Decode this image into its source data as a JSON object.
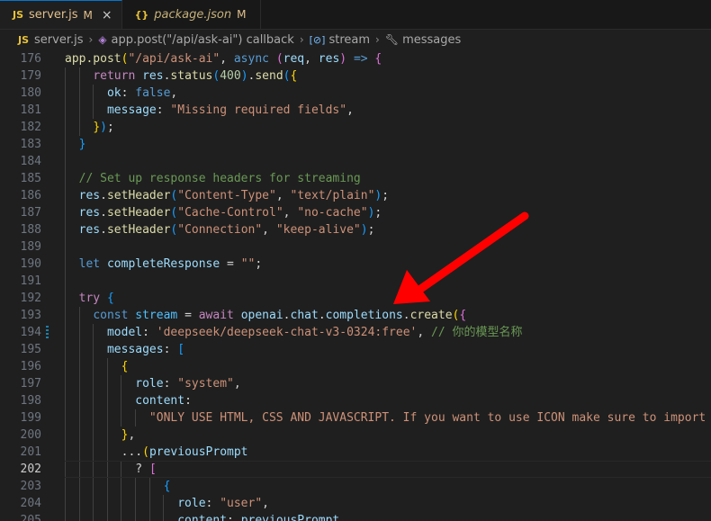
{
  "tabs": [
    {
      "icon": "JS",
      "name": "server.js",
      "modified": "M",
      "close": "×"
    },
    {
      "icon": "{}",
      "name": "package.json",
      "modified": "M"
    }
  ],
  "breadcrumb": [
    "server.js",
    "app.post(\"/api/ask-ai\") callback",
    "stream",
    "messages"
  ],
  "current_line": "202",
  "lines": [
    {
      "n": "176",
      "top": "app.post",
      "tokens": [
        [
          "f",
          "app.post"
        ],
        [
          "b1",
          "("
        ],
        [
          "s",
          "\"/api/ask-ai\""
        ],
        [
          "p",
          ", "
        ],
        [
          "k",
          "async"
        ],
        [
          "p",
          " "
        ],
        [
          "b2",
          "("
        ],
        [
          "v",
          "req"
        ],
        [
          "p",
          ", "
        ],
        [
          "v",
          "res"
        ],
        [
          "b2",
          ")"
        ],
        [
          "p",
          " "
        ],
        [
          "k",
          "=>"
        ],
        [
          "p",
          " "
        ],
        [
          "b2",
          "{"
        ]
      ]
    },
    {
      "n": "179",
      "tokens": [
        [
          "p",
          "    "
        ],
        [
          "kc",
          "return"
        ],
        [
          "p",
          " "
        ],
        [
          "v",
          "res"
        ],
        [
          "p",
          "."
        ],
        [
          "f",
          "status"
        ],
        [
          "b3",
          "("
        ],
        [
          "n",
          "400"
        ],
        [
          "b3",
          ")"
        ],
        [
          "p",
          "."
        ],
        [
          "f",
          "send"
        ],
        [
          "b3",
          "("
        ],
        [
          "b1",
          "{"
        ]
      ]
    },
    {
      "n": "180",
      "tokens": [
        [
          "p",
          "      "
        ],
        [
          "v",
          "ok"
        ],
        [
          "p",
          ": "
        ],
        [
          "k",
          "false"
        ],
        [
          "p",
          ","
        ]
      ]
    },
    {
      "n": "181",
      "tokens": [
        [
          "p",
          "      "
        ],
        [
          "v",
          "message"
        ],
        [
          "p",
          ": "
        ],
        [
          "s",
          "\"Missing required fields\""
        ],
        [
          "p",
          ","
        ]
      ]
    },
    {
      "n": "182",
      "tokens": [
        [
          "p",
          "    "
        ],
        [
          "b1",
          "}"
        ],
        [
          "b3",
          ")"
        ],
        [
          "p",
          ";"
        ]
      ]
    },
    {
      "n": "183",
      "tokens": [
        [
          "p",
          "  "
        ],
        [
          "b3",
          "}"
        ]
      ]
    },
    {
      "n": "184",
      "tokens": []
    },
    {
      "n": "185",
      "tokens": [
        [
          "p",
          "  "
        ],
        [
          "c",
          "// Set up response headers for streaming"
        ]
      ]
    },
    {
      "n": "186",
      "tokens": [
        [
          "p",
          "  "
        ],
        [
          "v",
          "res"
        ],
        [
          "p",
          "."
        ],
        [
          "f",
          "setHeader"
        ],
        [
          "b3",
          "("
        ],
        [
          "s",
          "\"Content-Type\""
        ],
        [
          "p",
          ", "
        ],
        [
          "s",
          "\"text/plain\""
        ],
        [
          "b3",
          ")"
        ],
        [
          "p",
          ";"
        ]
      ]
    },
    {
      "n": "187",
      "tokens": [
        [
          "p",
          "  "
        ],
        [
          "v",
          "res"
        ],
        [
          "p",
          "."
        ],
        [
          "f",
          "setHeader"
        ],
        [
          "b3",
          "("
        ],
        [
          "s",
          "\"Cache-Control\""
        ],
        [
          "p",
          ", "
        ],
        [
          "s",
          "\"no-cache\""
        ],
        [
          "b3",
          ")"
        ],
        [
          "p",
          ";"
        ]
      ]
    },
    {
      "n": "188",
      "tokens": [
        [
          "p",
          "  "
        ],
        [
          "v",
          "res"
        ],
        [
          "p",
          "."
        ],
        [
          "f",
          "setHeader"
        ],
        [
          "b3",
          "("
        ],
        [
          "s",
          "\"Connection\""
        ],
        [
          "p",
          ", "
        ],
        [
          "s",
          "\"keep-alive\""
        ],
        [
          "b3",
          ")"
        ],
        [
          "p",
          ";"
        ]
      ]
    },
    {
      "n": "189",
      "tokens": []
    },
    {
      "n": "190",
      "tokens": [
        [
          "p",
          "  "
        ],
        [
          "k",
          "let"
        ],
        [
          "p",
          " "
        ],
        [
          "v",
          "completeResponse"
        ],
        [
          "p",
          " = "
        ],
        [
          "s",
          "\"\""
        ],
        [
          "p",
          ";"
        ]
      ]
    },
    {
      "n": "191",
      "tokens": []
    },
    {
      "n": "192",
      "tokens": [
        [
          "p",
          "  "
        ],
        [
          "kc",
          "try"
        ],
        [
          "p",
          " "
        ],
        [
          "b3",
          "{"
        ]
      ]
    },
    {
      "n": "193",
      "tokens": [
        [
          "p",
          "    "
        ],
        [
          "k",
          "const"
        ],
        [
          "p",
          " "
        ],
        [
          "cst",
          "stream"
        ],
        [
          "p",
          " = "
        ],
        [
          "kc",
          "await"
        ],
        [
          "p",
          " "
        ],
        [
          "v",
          "openai"
        ],
        [
          "p",
          "."
        ],
        [
          "v",
          "chat"
        ],
        [
          "p",
          "."
        ],
        [
          "v",
          "completions"
        ],
        [
          "p",
          "."
        ],
        [
          "f",
          "create"
        ],
        [
          "b1",
          "("
        ],
        [
          "b2",
          "{"
        ]
      ]
    },
    {
      "n": "194",
      "tokens": [
        [
          "p",
          "      "
        ],
        [
          "v",
          "model"
        ],
        [
          "p",
          ": "
        ],
        [
          "s",
          "'deepseek/deepseek-chat-v3-0324:free'"
        ],
        [
          "p",
          ", "
        ],
        [
          "c",
          "// 你的模型名称"
        ]
      ]
    },
    {
      "n": "195",
      "tokens": [
        [
          "p",
          "      "
        ],
        [
          "v",
          "messages"
        ],
        [
          "p",
          ": "
        ],
        [
          "b3",
          "["
        ]
      ]
    },
    {
      "n": "196",
      "tokens": [
        [
          "p",
          "        "
        ],
        [
          "b1",
          "{"
        ]
      ]
    },
    {
      "n": "197",
      "tokens": [
        [
          "p",
          "          "
        ],
        [
          "v",
          "role"
        ],
        [
          "p",
          ": "
        ],
        [
          "s",
          "\"system\""
        ],
        [
          "p",
          ","
        ]
      ]
    },
    {
      "n": "198",
      "tokens": [
        [
          "p",
          "          "
        ],
        [
          "v",
          "content"
        ],
        [
          "p",
          ":"
        ]
      ]
    },
    {
      "n": "199",
      "tokens": [
        [
          "p",
          "            "
        ],
        [
          "s",
          "\"ONLY USE HTML, CSS AND JAVASCRIPT. If you want to use ICON make sure to import th"
        ]
      ]
    },
    {
      "n": "200",
      "tokens": [
        [
          "p",
          "        "
        ],
        [
          "b1",
          "}"
        ],
        [
          "p",
          ","
        ]
      ]
    },
    {
      "n": "201",
      "tokens": [
        [
          "p",
          "        "
        ],
        [
          "p",
          "..."
        ],
        [
          "b1",
          "("
        ],
        [
          "v",
          "previousPrompt"
        ]
      ]
    },
    {
      "n": "202",
      "tokens": [
        [
          "p",
          "          "
        ],
        [
          "p",
          "? "
        ],
        [
          "b2",
          "["
        ]
      ]
    },
    {
      "n": "203",
      "tokens": [
        [
          "p",
          "              "
        ],
        [
          "b3",
          "{"
        ]
      ]
    },
    {
      "n": "204",
      "tokens": [
        [
          "p",
          "                "
        ],
        [
          "v",
          "role"
        ],
        [
          "p",
          ": "
        ],
        [
          "s",
          "\"user\""
        ],
        [
          "p",
          ","
        ]
      ]
    },
    {
      "n": "205",
      "tokens": [
        [
          "p",
          "                "
        ],
        [
          "v",
          "content"
        ],
        [
          "p",
          ": "
        ],
        [
          "v",
          "previousPrompt"
        ],
        [
          "p",
          ","
        ]
      ]
    }
  ],
  "colors": {
    "arrow": "#ff0000",
    "accent": "#0078d4"
  }
}
